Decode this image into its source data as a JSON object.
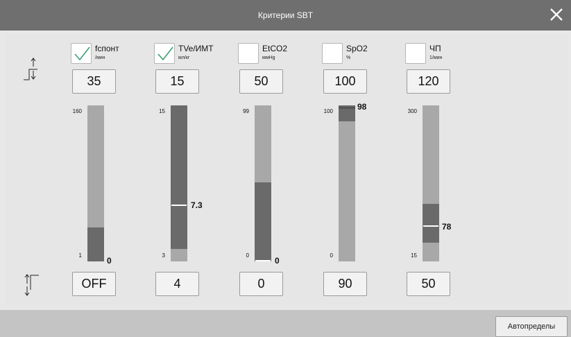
{
  "title": "Критерии SBT",
  "footer": {
    "auto_limits_label": "Автопределы"
  },
  "columns": [
    {
      "name": "fспонт",
      "unit": "/мин",
      "checked": true,
      "high": "35",
      "low": "OFF",
      "scale_top": "160",
      "scale_bottom": "1",
      "current": "0",
      "current_value": 0,
      "range": [
        1,
        160
      ]
    },
    {
      "name": "TVe/ИМТ",
      "unit": "мл/кг",
      "checked": true,
      "high": "15",
      "low": "4",
      "scale_top": "15",
      "scale_bottom": "3",
      "current": "7.3",
      "current_value": 7.3,
      "range": [
        3,
        15
      ]
    },
    {
      "name": "EtCO2",
      "unit": "ммHg",
      "checked": false,
      "high": "50",
      "low": "0",
      "scale_top": "99",
      "scale_bottom": "0",
      "current": "0",
      "current_value": 0,
      "range": [
        0,
        99
      ]
    },
    {
      "name": "SpO2",
      "unit": "%",
      "checked": false,
      "high": "100",
      "low": "90",
      "scale_top": "100",
      "scale_bottom": "0",
      "current": "98",
      "current_value": 98,
      "range": [
        0,
        100
      ]
    },
    {
      "name": "ЧП",
      "unit": "1/мин",
      "checked": false,
      "high": "120",
      "low": "50",
      "scale_top": "300",
      "scale_bottom": "15",
      "current": "78",
      "current_value": 78,
      "range": [
        15,
        300
      ]
    }
  ],
  "colors": {
    "titlebar": "#6f6f6f",
    "bar_bg": "#a8a8a8",
    "bar_fill": "#6a6a6a",
    "check": "#3aa070"
  }
}
